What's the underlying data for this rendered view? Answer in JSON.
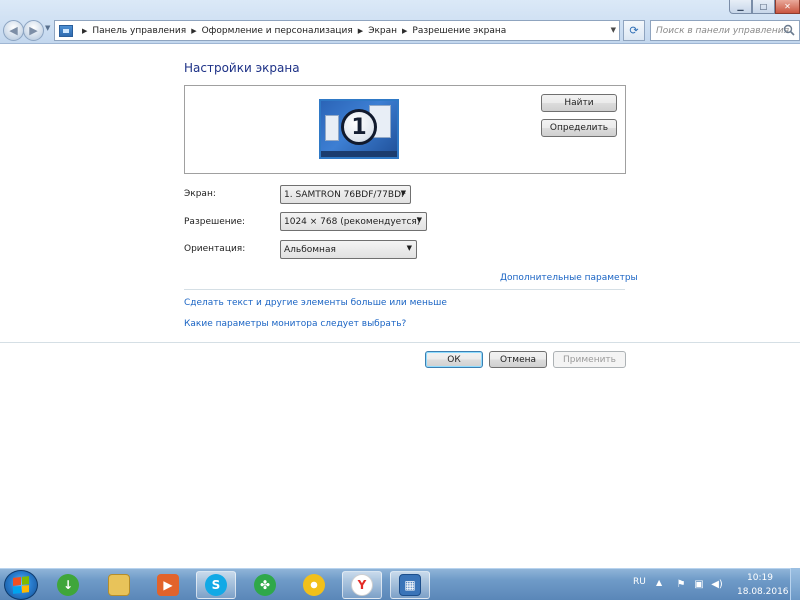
{
  "address_bar": {
    "crumbs": [
      "Панель управления",
      "Оформление и персонализация",
      "Экран",
      "Разрешение экрана"
    ],
    "search_placeholder": "Поиск в панели управления"
  },
  "page": {
    "title": "Настройки экрана",
    "monitor_number": "1",
    "find_button": "Найти",
    "identify_button": "Определить",
    "screen_label": "Экран:",
    "screen_value": "1. SAMTRON 76BDF/77BDF",
    "resolution_label": "Разрешение:",
    "resolution_value": "1024 × 768 (рекомендуется)",
    "orientation_label": "Ориентация:",
    "orientation_value": "Альбомная",
    "advanced_link": "Дополнительные параметры",
    "text_size_link": "Сделать текст и другие элементы больше или меньше",
    "which_monitor_link": "Какие параметры монитора следует выбрать?",
    "ok_button": "ОК",
    "cancel_button": "Отмена",
    "apply_button": "Применить"
  },
  "taskbar": {
    "pinned": [
      {
        "name": "downloader-icon",
        "color": "#3fa63a"
      },
      {
        "name": "explorer-icon",
        "color": "#e8c35a"
      },
      {
        "name": "media-player-icon",
        "color": "#e2632b"
      },
      {
        "name": "skype-icon",
        "color": "#12a9e6"
      },
      {
        "name": "clover-icon",
        "color": "#2fa84a"
      },
      {
        "name": "disc-icon",
        "color": "#f2c01b"
      },
      {
        "name": "yandex-browser-icon",
        "color": "#e32b26"
      },
      {
        "name": "control-panel-icon",
        "color": "#3a74b8"
      }
    ],
    "language": "RU",
    "time": "10:19",
    "date": "18.08.2016"
  }
}
